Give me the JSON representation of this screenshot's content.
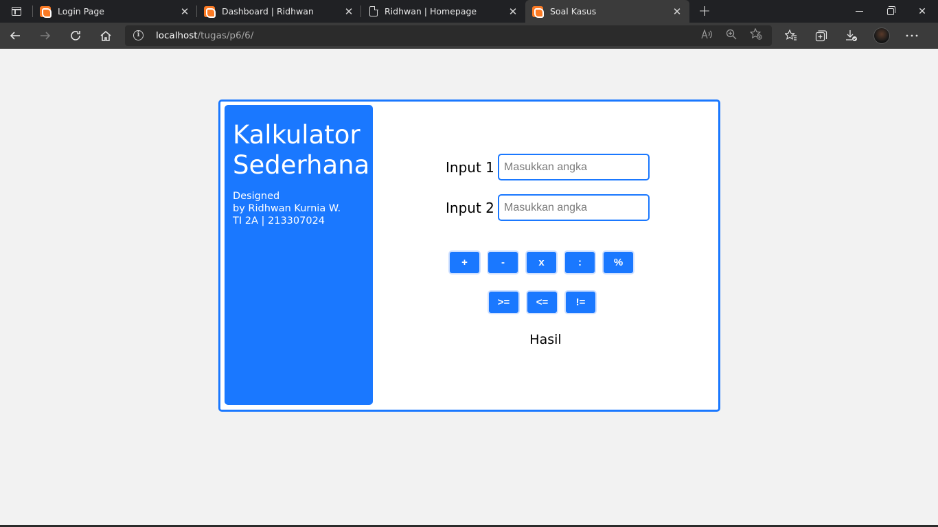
{
  "browser": {
    "tabs": [
      {
        "title": "Login Page",
        "favicon": "xampp-icon",
        "active": false
      },
      {
        "title": "Dashboard | Ridhwan",
        "favicon": "xampp-icon",
        "active": false
      },
      {
        "title": "Ridhwan | Homepage",
        "favicon": "page-icon",
        "active": false
      },
      {
        "title": "Soal Kasus",
        "favicon": "xampp-icon",
        "active": true
      }
    ],
    "close_glyph": "✕",
    "new_tab_glyph": "+",
    "url_host": "localhost",
    "url_path": "/tugas/p6/6/"
  },
  "sidebar": {
    "title_line1": "Kalkulator",
    "title_line2": "Sederhana",
    "credit_line1": "Designed",
    "credit_line2": "by Ridhwan Kurnia W.",
    "credit_line3": "TI 2A | 213307024"
  },
  "form": {
    "input1_label": "Input 1",
    "input1_placeholder": "Masukkan angka",
    "input1_value": "",
    "input2_label": "Input 2",
    "input2_placeholder": "Masukkan angka",
    "input2_value": "",
    "operators_row1": [
      "+",
      "-",
      "x",
      ":",
      "%"
    ],
    "operators_row2": [
      ">=",
      "<=",
      "!="
    ],
    "result_label": "Hasil"
  },
  "colors": {
    "accent": "#1a78ff",
    "page_bg": "#f2f2f2"
  }
}
